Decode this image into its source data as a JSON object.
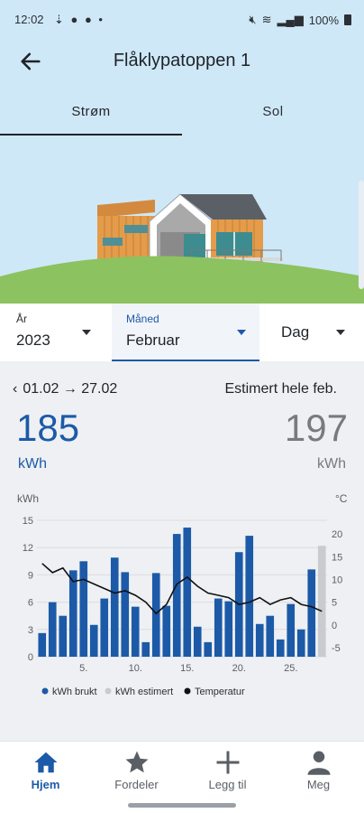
{
  "status": {
    "time": "12:02",
    "battery": "100%",
    "left_icons": "⇣ ● ● •"
  },
  "header": {
    "title": "Flåklypatoppen 1"
  },
  "tabs": [
    {
      "label": "Strøm",
      "selected": true
    },
    {
      "label": "Sol",
      "selected": false
    }
  ],
  "selectors": {
    "year": {
      "label": "År",
      "value": "2023"
    },
    "month": {
      "label": "Måned",
      "value": "Februar"
    },
    "day": {
      "value": "Dag"
    }
  },
  "summary": {
    "period": "01.02 → 27.02",
    "estimate_label": "Estimert hele feb.",
    "used_value": "185",
    "used_unit": "kWh",
    "estimate_value": "197",
    "estimate_unit": "kWh"
  },
  "colors": {
    "accent": "#1c5aa8",
    "estimate_bar": "#c9cbcf",
    "temperature_line": "#111111"
  },
  "chart_data": {
    "type": "bar",
    "ylabel_left": "kWh",
    "ylabel_right": "°C",
    "ylim": [
      0,
      15
    ],
    "y2lim": [
      -7,
      23
    ],
    "yticks": [
      "0",
      "3",
      "6",
      "9",
      "12",
      "15"
    ],
    "y2ticks": [
      "-5",
      "0",
      "5",
      "10",
      "15",
      "20"
    ],
    "xticks": [
      "5.",
      "10.",
      "15.",
      "20.",
      "25."
    ],
    "x": [
      1,
      2,
      3,
      4,
      5,
      6,
      7,
      8,
      9,
      10,
      11,
      12,
      13,
      14,
      15,
      16,
      17,
      18,
      19,
      20,
      21,
      22,
      23,
      24,
      25,
      26,
      27,
      28
    ],
    "series": [
      {
        "name": "kWh brukt",
        "color": "#1c5aa8",
        "values": [
          2.6,
          6.0,
          4.5,
          9.5,
          10.5,
          3.5,
          6.4,
          10.9,
          9.3,
          5.5,
          1.6,
          9.2,
          5.6,
          13.5,
          14.2,
          3.3,
          1.6,
          6.4,
          6.1,
          11.5,
          13.3,
          3.6,
          4.5,
          1.9,
          5.8,
          3.0,
          9.6,
          0
        ]
      },
      {
        "name": "kWh estimert",
        "color": "#c9cbcf",
        "values": [
          0,
          0,
          0,
          0,
          0,
          0,
          0,
          0,
          0,
          0,
          0,
          0,
          0,
          0,
          0,
          0,
          0,
          0,
          0,
          0,
          0,
          0,
          0,
          0,
          0,
          0,
          0,
          12.2
        ]
      },
      {
        "name": "Temperatur",
        "color": "#111111",
        "axis": "right",
        "values": [
          13.5,
          11.5,
          12.5,
          9.5,
          10.0,
          9.0,
          8.0,
          7.0,
          7.5,
          6.5,
          5.0,
          2.5,
          4.5,
          9.0,
          10.5,
          8.5,
          7.0,
          6.5,
          6.0,
          4.5,
          5.0,
          6.0,
          4.5,
          5.5,
          6.0,
          4.5,
          4.0,
          3.0
        ]
      }
    ],
    "legend": [
      {
        "label": "kWh brukt",
        "color": "#1c5aa8"
      },
      {
        "label": "kWh estimert",
        "color": "#c9cbcf"
      },
      {
        "label": "Temperatur",
        "color": "#111111"
      }
    ],
    "legend_position": "bottom"
  },
  "nav": [
    {
      "label": "Hjem",
      "icon": "home-icon",
      "active": true
    },
    {
      "label": "Fordeler",
      "icon": "star-icon",
      "active": false
    },
    {
      "label": "Legg til",
      "icon": "plus-icon",
      "active": false
    },
    {
      "label": "Meg",
      "icon": "person-icon",
      "active": false
    }
  ]
}
